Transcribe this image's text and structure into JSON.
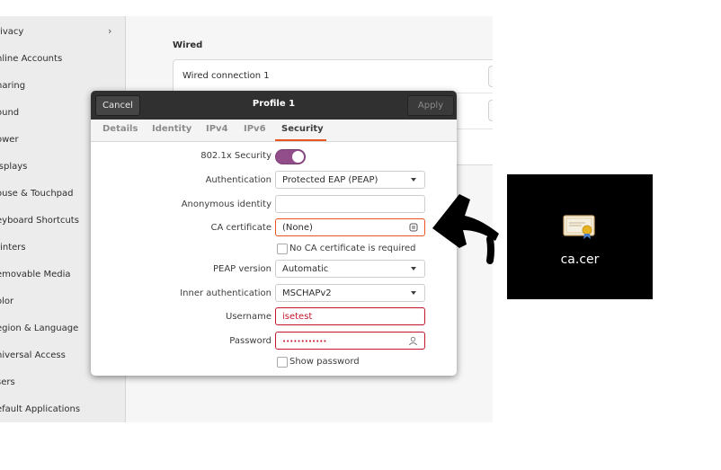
{
  "sidebar": {
    "items": [
      {
        "label": "rivacy",
        "chevron": true
      },
      {
        "label": "nline Accounts"
      },
      {
        "label": "haring"
      },
      {
        "label": "ound"
      },
      {
        "label": "ower"
      },
      {
        "label": "isplays"
      },
      {
        "label": "ouse & Touchpad"
      },
      {
        "label": "eyboard Shortcuts"
      },
      {
        "label": "rinters"
      },
      {
        "label": "emovable Media"
      },
      {
        "label": "olor"
      },
      {
        "label": "egion & Language"
      },
      {
        "label": "niversal Access"
      },
      {
        "label": "sers"
      },
      {
        "label": "efault Applications"
      }
    ]
  },
  "network": {
    "section_title": "Wired",
    "connection_name": "Wired connection 1"
  },
  "dialog": {
    "title": "Profile 1",
    "cancel_label": "Cancel",
    "apply_label": "Apply",
    "tabs": [
      "Details",
      "Identity",
      "IPv4",
      "IPv6",
      "Security"
    ],
    "active_tab": "Security",
    "security": {
      "toggle_label": "802.1x Security",
      "toggle_on": true,
      "auth_label": "Authentication",
      "auth_value": "Protected EAP (PEAP)",
      "anon_label": "Anonymous identity",
      "anon_value": "",
      "ca_label": "CA certificate",
      "ca_value": "(None)",
      "no_ca_label": "No CA certificate is required",
      "peap_label": "PEAP version",
      "peap_value": "Automatic",
      "inner_label": "Inner authentication",
      "inner_value": "MSCHAPv2",
      "user_label": "Username",
      "user_value": "isetest",
      "pass_label": "Password",
      "pass_value": "••••••••••••",
      "show_pass_label": "Show password"
    }
  },
  "annotation": {
    "file_name": "ca.cer",
    "arrow_color": "#000000"
  },
  "colors": {
    "accent": "#e95420",
    "toggle": "#924d8b",
    "error": "#c7162b"
  }
}
